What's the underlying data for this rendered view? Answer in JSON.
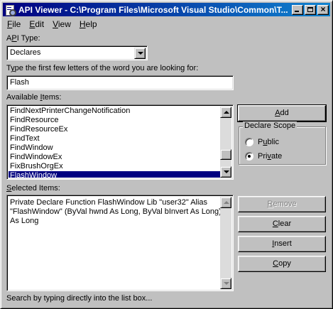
{
  "window": {
    "title": "API Viewer - C:\\Program Files\\Microsoft Visual Studio\\Common\\T..."
  },
  "menu": {
    "file": {
      "accel": "F",
      "rest": "ile"
    },
    "edit": {
      "accel": "E",
      "rest": "dit"
    },
    "view": {
      "accel": "V",
      "rest": "iew"
    },
    "help": {
      "accel": "H",
      "rest": "elp"
    }
  },
  "api_type": {
    "label_accel": "P",
    "label_pre": "A",
    "label_post": "I Type:",
    "selected": "Declares"
  },
  "search": {
    "label_accel": "y",
    "label_pre": "T",
    "label_post": "pe the first few letters of the word you are looking for:",
    "value": "Flash"
  },
  "available": {
    "label_pre": "Available ",
    "label_accel": "I",
    "label_post": "tems:",
    "items": [
      "FindNextPrinterChangeNotification",
      "FindResource",
      "FindResourceEx",
      "FindText",
      "FindWindow",
      "FindWindowEx",
      "FixBrushOrgEx",
      "FlashWindow"
    ],
    "selected_index": 7
  },
  "selected_items": {
    "label_accel": "S",
    "label_post": "elected Items:",
    "text": "Private Declare Function FlashWindow Lib \"user32\" Alias \"FlashWindow\" (ByVal hwnd As Long, ByVal bInvert As Long) As Long"
  },
  "buttons": {
    "add": {
      "accel": "A",
      "rest": "dd"
    },
    "remove": {
      "accel": "R",
      "rest": "emove"
    },
    "clear": {
      "accel": "C",
      "rest": "lear"
    },
    "insert": {
      "accel": "I",
      "rest": "nsert"
    },
    "copy": {
      "accel": "C",
      "rest": "opy"
    }
  },
  "declare_scope": {
    "title": "Declare Scope",
    "public": {
      "accel": "u",
      "pre": "P",
      "post": "blic",
      "checked": false
    },
    "private": {
      "accel": "v",
      "pre": "Pri",
      "post": "ate",
      "checked": true
    }
  },
  "status": "Search by typing directly into the list box...",
  "icons": {
    "app": "api-viewer-icon",
    "minimize": "minimize-icon",
    "maximize": "maximize-icon",
    "close": "close-icon"
  },
  "colors": {
    "titlebar_start": "#000080",
    "titlebar_end": "#1084d0",
    "selection": "#000080",
    "face": "#c0c0c0"
  }
}
